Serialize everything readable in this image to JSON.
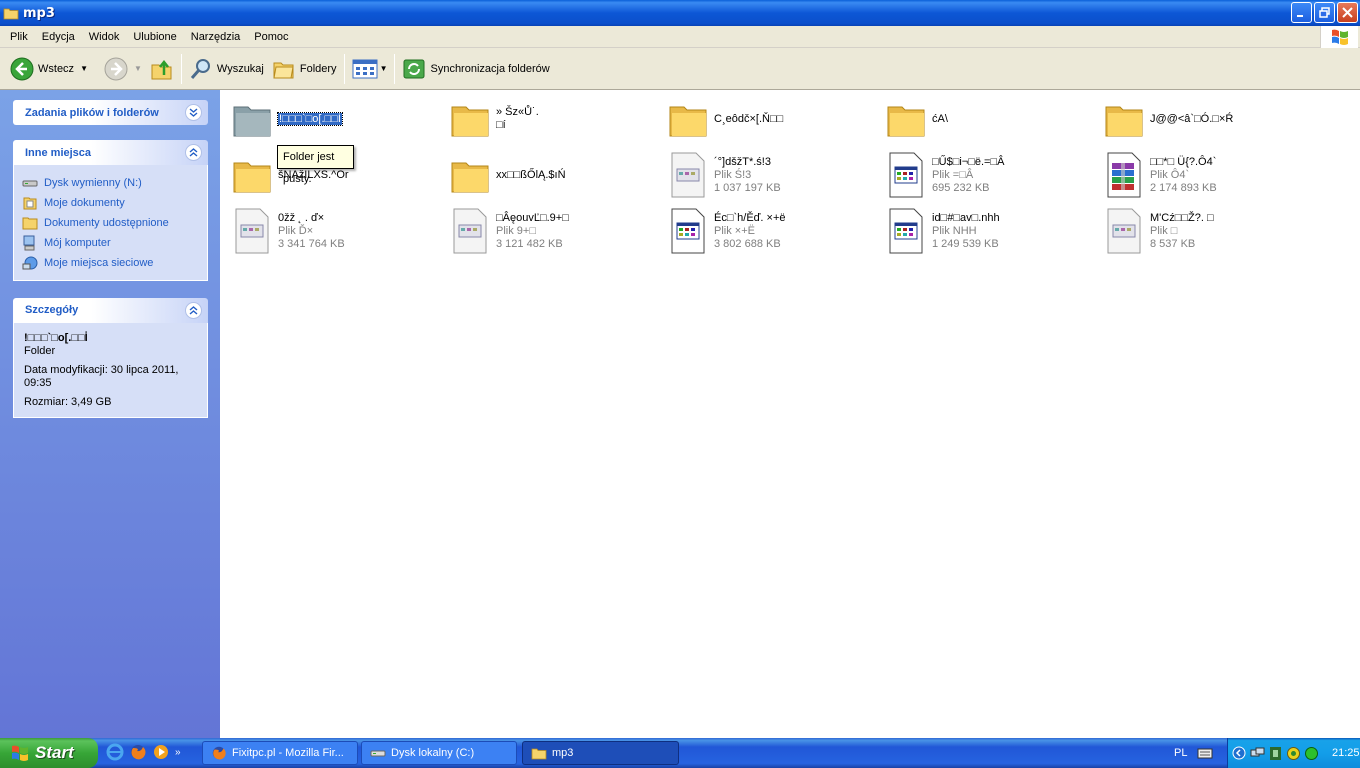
{
  "window": {
    "title": "mp3"
  },
  "menu": [
    "Plik",
    "Edycja",
    "Widok",
    "Ulubione",
    "Narzędzia",
    "Pomoc"
  ],
  "toolbar": {
    "back_label": "Wstecz",
    "search_label": "Wyszukaj",
    "folders_label": "Foldery",
    "sync_label": "Synchronizacja folderów"
  },
  "tasks_panel": {
    "title": "Zadania plików i folderów"
  },
  "other_places": {
    "title": "Inne miejsca",
    "links": [
      {
        "label": "Dysk wymienny (N:)",
        "icon": "removable-drive-icon"
      },
      {
        "label": "Moje dokumenty",
        "icon": "my-documents-icon"
      },
      {
        "label": "Dokumenty udostępnione",
        "icon": "shared-folder-icon"
      },
      {
        "label": "Mój komputer",
        "icon": "my-computer-icon"
      },
      {
        "label": "Moje miejsca sieciowe",
        "icon": "network-places-icon"
      }
    ]
  },
  "details": {
    "title": "Szczegóły",
    "name": "!□□□`□o[.□□İ",
    "type": "Folder",
    "modified": "Data modyfikacji: 30 lipca 2011, 09:35",
    "size": "Rozmiar: 3,49 GB"
  },
  "tooltip": "Folder jest pusty.",
  "items": [
    {
      "name": "!□□□`□o[.□□İ",
      "sub1": "",
      "sub2": "",
      "kind": "folder-gray",
      "selected": true
    },
    {
      "name": "» Šz«Ů˙.",
      "sub1": "□í",
      "sub2": "",
      "kind": "folder"
    },
    {
      "name": "C¸eôdč×[.Ň□□",
      "sub1": "",
      "sub2": "",
      "kind": "folder"
    },
    {
      "name": "ćA\\",
      "sub1": "",
      "sub2": "",
      "kind": "folder"
    },
    {
      "name": "J@@<â`□Ó.□×Ŕ",
      "sub1": "",
      "sub2": "",
      "kind": "folder"
    },
    {
      "name": "šNAžILXS.^Or",
      "sub1": "",
      "sub2": "",
      "kind": "folder"
    },
    {
      "name": "xx□□ßŐlĄ.$ıŃ",
      "sub1": "",
      "sub2": "",
      "kind": "folder"
    },
    {
      "name": "´°]dšžT*.ś!3",
      "sub1": "Plik Ś!3",
      "sub2": "1 037 197 KB",
      "kind": "file-light"
    },
    {
      "name": "□Ű$□i¬□ë.=□Â",
      "sub1": "Plik =□Â",
      "sub2": "695 232 KB",
      "kind": "file-dark"
    },
    {
      "name": "□□*□ Ü{?.Ô4`",
      "sub1": "Plik Ô4`",
      "sub2": "2 174 893 KB",
      "kind": "archive"
    },
    {
      "name": "0žž ˛ . ď×",
      "sub1": "Plik Ď×",
      "sub2": "3 341 764 KB",
      "kind": "file-light"
    },
    {
      "name": "□ÂęouvĽ□.9+□",
      "sub1": "Plik 9+□",
      "sub2": "3 121 482 KB",
      "kind": "file-light"
    },
    {
      "name": "Éc□`h/Ěď. ×+ë",
      "sub1": "Plik ×+Ë",
      "sub2": "3 802 688 KB",
      "kind": "file-dark"
    },
    {
      "name": "id□#□av□.nhh",
      "sub1": "Plik NHH",
      "sub2": "1 249 539 KB",
      "kind": "file-dark"
    },
    {
      "name": "M'Cź□□Ž?. □",
      "sub1": "Plik □",
      "sub2": "8 537 KB",
      "kind": "file-light"
    }
  ],
  "taskbar": {
    "start_label": "Start",
    "tasks": [
      {
        "label": "Fixitpc.pl - Mozilla Fir..."
      },
      {
        "label": "Dysk lokalny (C:)"
      },
      {
        "label": "mp3"
      }
    ],
    "language": "PL",
    "clock": "21:25"
  }
}
